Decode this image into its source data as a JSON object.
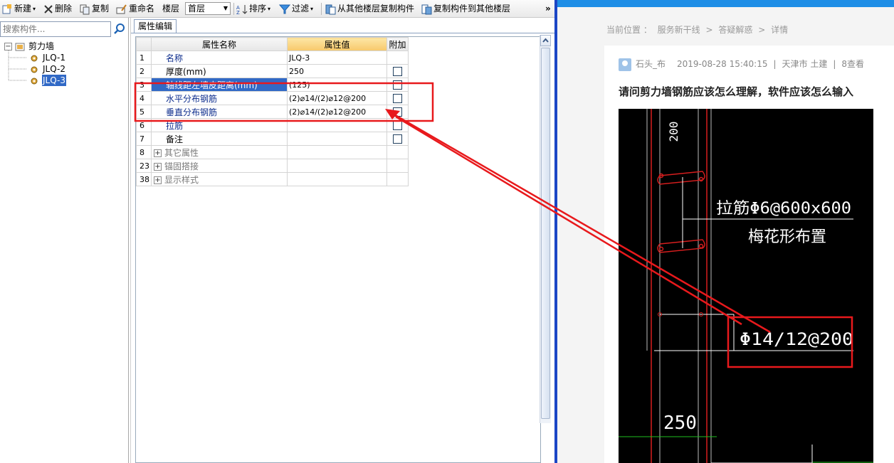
{
  "toolbar": {
    "new_label": "新建",
    "delete_label": "删除",
    "copy_label": "复制",
    "rename_label": "重命名",
    "floor_label": "楼层",
    "floor_value": "首层",
    "sort_label": "排序",
    "filter_label": "过滤",
    "copy_from_floor_label": "从其他楼层复制构件",
    "copy_to_floor_label": "复制构件到其他楼层",
    "more_label": "»"
  },
  "search": {
    "placeholder": "搜索构件..."
  },
  "tree": {
    "root": "剪力墙",
    "items": [
      "JLQ-1",
      "JLQ-2",
      "JLQ-3"
    ]
  },
  "tab": {
    "label": "属性编辑"
  },
  "grid": {
    "headers": {
      "name": "属性名称",
      "value": "属性值",
      "extra": "附加"
    },
    "rows": [
      {
        "num": "1",
        "name": "名称",
        "value": "JLQ-3"
      },
      {
        "num": "2",
        "name": "厚度(mm)",
        "value": "250"
      },
      {
        "num": "3",
        "name": "轴线距左墙皮距离(mm)",
        "value": "(125)"
      },
      {
        "num": "4",
        "name": "水平分布钢筋",
        "value": "(2)⌀14/(2)⌀12@200"
      },
      {
        "num": "5",
        "name": "垂直分布钢筋",
        "value": "(2)⌀14/(2)⌀12@200"
      },
      {
        "num": "6",
        "name": "拉筋",
        "value": ""
      },
      {
        "num": "7",
        "name": "备注",
        "value": ""
      },
      {
        "num": "8",
        "name": "其它属性",
        "value": ""
      },
      {
        "num": "23",
        "name": "锚固搭接",
        "value": ""
      },
      {
        "num": "38",
        "name": "显示样式",
        "value": ""
      }
    ]
  },
  "web": {
    "breadcrumb": {
      "prefix": "当前位置 ：",
      "l1": "服务新干线",
      "sep": ">",
      "l2": "答疑解惑",
      "l3": "详情"
    },
    "meta": {
      "user": "石头_布",
      "datetime": "2019-08-28 15:40:15",
      "divider": "|",
      "location": "天津市  土建",
      "views": "8查看"
    },
    "question_title": "请问剪力墙钢筋应该怎么理解，软件应该怎么输入",
    "cad": {
      "dim_top": "200",
      "tie_label": "拉筋Φ6@600x600",
      "tie_layout": "梅花形布置",
      "rebar_label": "Φ14/12@200",
      "dim_bottom": "250"
    }
  },
  "colors": {
    "annotation_red": "#e8191c",
    "cad_line_red": "#d81e1e",
    "selection_blue": "#3169c6"
  }
}
